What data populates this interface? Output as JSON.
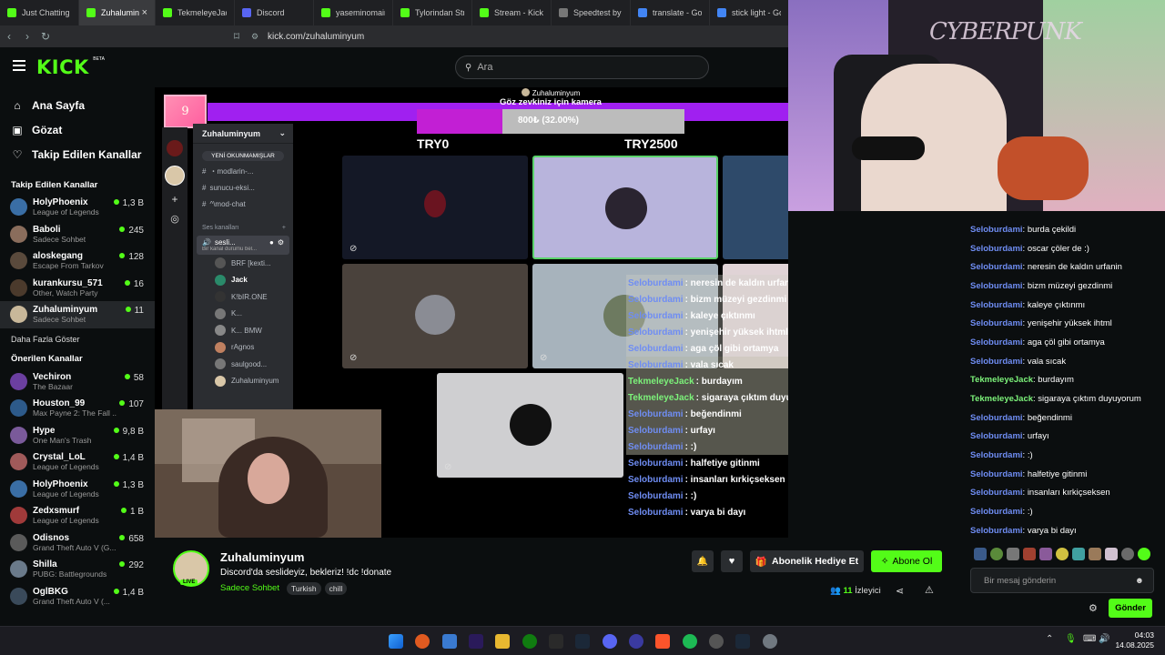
{
  "browser": {
    "tabs": [
      {
        "label": "Just Chatting S",
        "color": "#53fc18",
        "glyph": "K"
      },
      {
        "label": "Zuhalumin",
        "color": "#53fc18",
        "glyph": "K",
        "active": true
      },
      {
        "label": "TekmeleyeJack",
        "color": "#53fc18",
        "glyph": "K"
      },
      {
        "label": "Discord",
        "color": "#5865f2",
        "glyph": "D"
      },
      {
        "label": "yaseminomair S",
        "color": "#53fc18",
        "glyph": "K"
      },
      {
        "label": "Tylorindan Stre",
        "color": "#53fc18",
        "glyph": "K"
      },
      {
        "label": "Stream - Kick D",
        "color": "#53fc18",
        "glyph": "K"
      },
      {
        "label": "Speedtest by O",
        "color": "#777",
        "glyph": "◷"
      },
      {
        "label": "translate - Goo",
        "color": "#4285f4",
        "glyph": "G"
      },
      {
        "label": "stick light - Goo",
        "color": "#4285f4",
        "glyph": "G"
      }
    ],
    "tab_close": "×",
    "url": "kick.com/zuhaluminyum"
  },
  "header": {
    "logo": "KICK",
    "beta": "BETA",
    "search_placeholder": "Ara"
  },
  "sidebar": {
    "nav": [
      {
        "label": "Ana Sayfa",
        "icon": "home-icon",
        "glyph": "⌂"
      },
      {
        "label": "Gözat",
        "icon": "browse-icon",
        "glyph": "▣"
      },
      {
        "label": "Takip Edilen Kanallar",
        "icon": "heart-icon",
        "glyph": "♡"
      }
    ],
    "followed_heading": "Takip Edilen Kanallar",
    "followed": [
      {
        "name": "HolyPhoenix",
        "game": "League of Legends",
        "viewers": "1,3 B",
        "color": "#3a6ea5"
      },
      {
        "name": "Baboli",
        "game": "Sadece Sohbet",
        "viewers": "245",
        "color": "#8a6d5c"
      },
      {
        "name": "aloskegang",
        "game": "Escape From Tarkov",
        "viewers": "128",
        "color": "#5a4a3c"
      },
      {
        "name": "kurankursu_571",
        "game": "Other, Watch Party",
        "viewers": "16",
        "color": "#4b3a2c"
      },
      {
        "name": "Zuhaluminyum",
        "game": "Sadece Sohbet",
        "viewers": "11",
        "color": "#c8b89a"
      }
    ],
    "show_more": "Daha Fazla Göster",
    "recommended_heading": "Önerilen Kanallar",
    "recommended": [
      {
        "name": "Vechiron",
        "game": "The Bazaar",
        "viewers": "58",
        "color": "#6b3fa0"
      },
      {
        "name": "Houston_99",
        "game": "Max Payne 2: The Fall ...",
        "viewers": "107",
        "color": "#2d5a8a"
      },
      {
        "name": "Hype",
        "game": "One Man's Trash",
        "viewers": "9,8 B",
        "color": "#7a5a9a"
      },
      {
        "name": "Crystal_LoL",
        "game": "League of Legends",
        "viewers": "1,4 B",
        "color": "#a05a5a"
      },
      {
        "name": "HolyPhoenix",
        "game": "League of Legends",
        "viewers": "1,3 B",
        "color": "#3a6ea5"
      },
      {
        "name": "Zedxsmurf",
        "game": "League of Legends",
        "viewers": "1 B",
        "color": "#a03a3a"
      },
      {
        "name": "Odisnos",
        "game": "Grand Theft Auto V (G...",
        "viewers": "658",
        "color": "#5a5a5a"
      },
      {
        "name": "Shilla",
        "game": "PUBG: Battlegrounds",
        "viewers": "292",
        "color": "#6a7a8a"
      },
      {
        "name": "OglBKG",
        "game": "Grand Theft Auto V (...",
        "viewers": "1,4 B",
        "color": "#3a4a5a"
      }
    ]
  },
  "overlay": {
    "donation_badge": "9",
    "goal_user": "Zuhaluminyum",
    "goal_title": "Göz zevkiniz için kamera",
    "goal_text": "800₺ (32.00%)",
    "goal_progress": 0.32,
    "goal_min": "TRY0",
    "goal_max": "TRY2500"
  },
  "discord": {
    "server_name": "Zuhaluminyum",
    "unread": "YENİ OKUNMAMIŞLAR",
    "text_channels": [
      "・modlarin-...",
      "sunucu-eksi...",
      "^\\mod-chat"
    ],
    "voice_heading": "Ses kanalları",
    "voice_channel": "sesli...",
    "voice_sub": "Bir kanal durumu bel...",
    "members": [
      "BRF [kexti...",
      "Jack",
      "K!bIR.ONE",
      "K...",
      "K...  BMW",
      "rAgnos",
      "saulgood...",
      "Zuhaluminyum"
    ]
  },
  "overlay_chat": [
    {
      "user": "Seloburdami",
      "msg": ": neresin de kaldın urfanin",
      "color": "blue"
    },
    {
      "user": "Seloburdami",
      "msg": ": bizm müzeyi gezdinmi",
      "color": "blue"
    },
    {
      "user": "Seloburdami",
      "msg": ": kaleye çıktınmı",
      "color": "blue"
    },
    {
      "user": "Seloburdami",
      "msg": ": yenişehir yüksek ihtml",
      "color": "blue"
    },
    {
      "user": "Seloburdami",
      "msg": ": aga çöl gibi ortamya",
      "color": "blue"
    },
    {
      "user": "Seloburdami",
      "msg": ": vala sıcak",
      "color": "blue"
    },
    {
      "user": "TekmeleyeJack",
      "msg": ": burdayım",
      "color": "green"
    },
    {
      "user": "TekmeleyeJack",
      "msg": ": sigaraya çıktım duyuyorum",
      "color": "green"
    },
    {
      "user": "Seloburdami",
      "msg": ": beğendinmi",
      "color": "blue"
    },
    {
      "user": "Seloburdami",
      "msg": ": urfayı",
      "color": "blue"
    },
    {
      "user": "Seloburdami",
      "msg": ": :)",
      "color": "blue"
    },
    {
      "user": "Seloburdami",
      "msg": ": halfetiye gitinmi",
      "color": "blue"
    },
    {
      "user": "Seloburdami",
      "msg": ": insanları kırkiçseksen",
      "color": "blue"
    },
    {
      "user": "Seloburdami",
      "msg": ": :)",
      "color": "blue"
    },
    {
      "user": "Seloburdami",
      "msg": ": varya bi dayı",
      "color": "blue"
    }
  ],
  "chat": {
    "messages": [
      {
        "user": "Seloburdami",
        "msg": ": burda çekildi",
        "color": "blue"
      },
      {
        "user": "Seloburdami",
        "msg": ": oscar çöler de :)",
        "color": "blue"
      },
      {
        "user": "Seloburdami",
        "msg": ": neresin de kaldın urfanin",
        "color": "blue"
      },
      {
        "user": "Seloburdami",
        "msg": ": bizm müzeyi gezdinmi",
        "color": "blue"
      },
      {
        "user": "Seloburdami",
        "msg": ": kaleye çıktınmı",
        "color": "blue"
      },
      {
        "user": "Seloburdami",
        "msg": ": yenişehir yüksek ihtml",
        "color": "blue"
      },
      {
        "user": "Seloburdami",
        "msg": ": aga çöl gibi ortamya",
        "color": "blue"
      },
      {
        "user": "Seloburdami",
        "msg": ": vala sıcak",
        "color": "blue"
      },
      {
        "user": "TekmeleyeJack",
        "msg": ": burdayım",
        "color": "green"
      },
      {
        "user": "TekmeleyeJack",
        "msg": ": sigaraya çıktım duyuyorum",
        "color": "green"
      },
      {
        "user": "Seloburdami",
        "msg": ": beğendinmi",
        "color": "blue"
      },
      {
        "user": "Seloburdami",
        "msg": ": urfayı",
        "color": "blue"
      },
      {
        "user": "Seloburdami",
        "msg": ": :)",
        "color": "blue"
      },
      {
        "user": "Seloburdami",
        "msg": ": halfetiye gitinmi",
        "color": "blue"
      },
      {
        "user": "Seloburdami",
        "msg": ": insanları kırkiçseksen",
        "color": "blue"
      },
      {
        "user": "Seloburdami",
        "msg": ": :)",
        "color": "blue"
      },
      {
        "user": "Seloburdami",
        "msg": ": varya bi dayı",
        "color": "blue"
      }
    ],
    "input_placeholder": "Bir mesaj gönderin",
    "send_label": "Gönder"
  },
  "stream_info": {
    "channel": "Zuhaluminyum",
    "live_badge": "LIVE",
    "title": "Discord'da seslideyiz, bekleriz! !dc !donate",
    "category": "Sadece Sohbet",
    "tags": [
      "Turkish",
      "chill"
    ],
    "gift_label": "Abonelik Hediye Et",
    "subscribe_label": "Abone Ol",
    "viewer_count": "11",
    "viewer_label": "İzleyici"
  },
  "taskbar": {
    "time": "04:03",
    "date": "14.08.2025"
  },
  "colors": {
    "kick_green": "#53fc18",
    "goal_purple": "#a020f0",
    "goal_magenta": "#c21fd4",
    "user_blue": "#6f8df3",
    "user_green": "#7cf27a"
  }
}
